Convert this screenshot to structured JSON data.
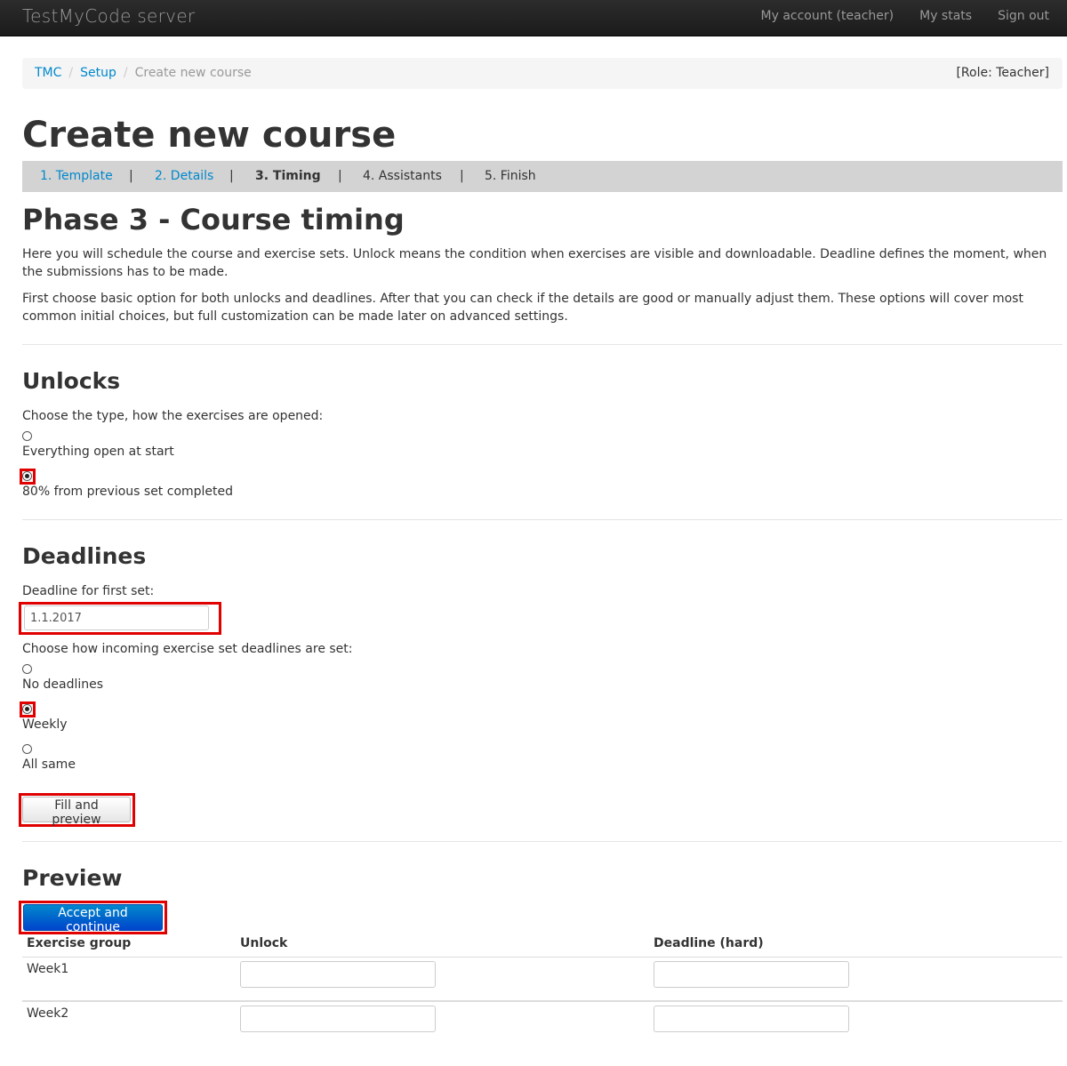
{
  "navbar": {
    "brand": "TestMyCode server",
    "links": [
      "My account (teacher)",
      "My stats",
      "Sign out"
    ]
  },
  "breadcrumb": {
    "items": [
      "TMC",
      "Setup"
    ],
    "current": "Create new course",
    "separator": "/",
    "role": "[Role: Teacher]"
  },
  "page_title": "Create new course",
  "steps": {
    "items": [
      "1. Template",
      "2. Details",
      "3. Timing",
      "4. Assistants",
      "5. Finish"
    ],
    "separator": "|"
  },
  "phase_title": "Phase 3 - Course timing",
  "intro": {
    "p1": "Here you will schedule the course and exercise sets. Unlock means the condition when exercises are visible and downloadable. Deadline defines the moment, when the submissions has to be made.",
    "p2": "First choose basic option for both unlocks and deadlines. After that you can check if the details are good or manually adjust them. These options will cover most common initial choices, but full customization can be made later on advanced settings."
  },
  "unlocks": {
    "title": "Unlocks",
    "prompt": "Choose the type, how the exercises are opened:",
    "options": [
      "Everything open at start",
      "80% from previous set completed"
    ],
    "selected": "80% from previous set completed"
  },
  "deadlines": {
    "title": "Deadlines",
    "first_label": "Deadline for first set:",
    "first_value": "1.1.2017",
    "prompt": "Choose how incoming exercise set deadlines are set:",
    "options": [
      "No deadlines",
      "Weekly",
      "All same"
    ],
    "selected": "Weekly",
    "fill_button": "Fill and preview"
  },
  "preview": {
    "title": "Preview",
    "accept_button": "Accept and continue",
    "columns": [
      "Exercise group",
      "Unlock",
      "Deadline (hard)"
    ],
    "rows": [
      {
        "group": "Week1",
        "unlock": "",
        "deadline": ""
      },
      {
        "group": "Week2",
        "unlock": "",
        "deadline": ""
      }
    ]
  },
  "colors": {
    "navbar": "#1b1b1b",
    "link": "#0088cc",
    "primary_button": "#0055cc",
    "highlight": "#e00000",
    "steps_bar": "#d3d3d3"
  }
}
